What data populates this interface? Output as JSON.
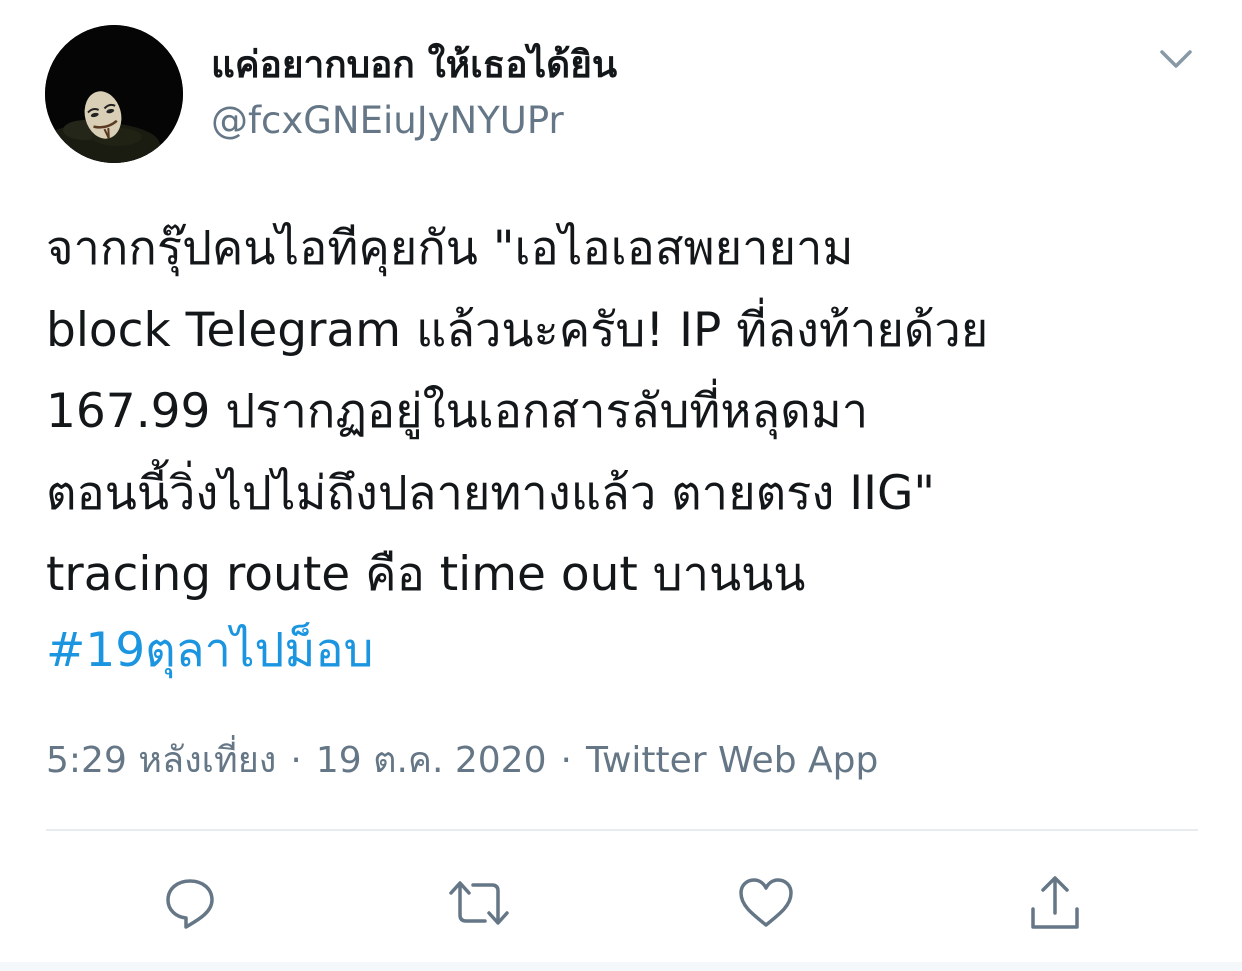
{
  "user": {
    "display_name": "แค่อยากบอก ให้เธอได้ยิน",
    "handle": "@fcxGNEiuJyNYUPr"
  },
  "tweet": {
    "lines": [
      "จากกรุ๊ปคนไอทีคุยกัน \"เอไอเอสพยายาม",
      "block Telegram แล้วนะครับ! IP ที่ลงท้ายด้วย",
      "167.99 ปรากฏอยู่ในเอกสารลับที่หลุดมา",
      "ตอนนี้วิ่งไปไม่ถึงปลายทางแล้ว ตายตรง IIG\"",
      "tracing route คือ time out บานนน"
    ],
    "hashtag": "#19ตุลาไปม็อบ"
  },
  "meta": {
    "time": "5:29 หลังเที่ยง",
    "separator": "·",
    "date": "19 ต.ค. 2020",
    "source": "Twitter Web App"
  },
  "icons": {
    "caret": "chevron-down-icon",
    "reply": "reply-icon",
    "retweet": "retweet-icon",
    "like": "heart-icon",
    "share": "share-icon"
  },
  "colors": {
    "text": "#14171a",
    "secondary": "#657786",
    "link": "#1b95e0",
    "divider": "#e6ecf0"
  }
}
